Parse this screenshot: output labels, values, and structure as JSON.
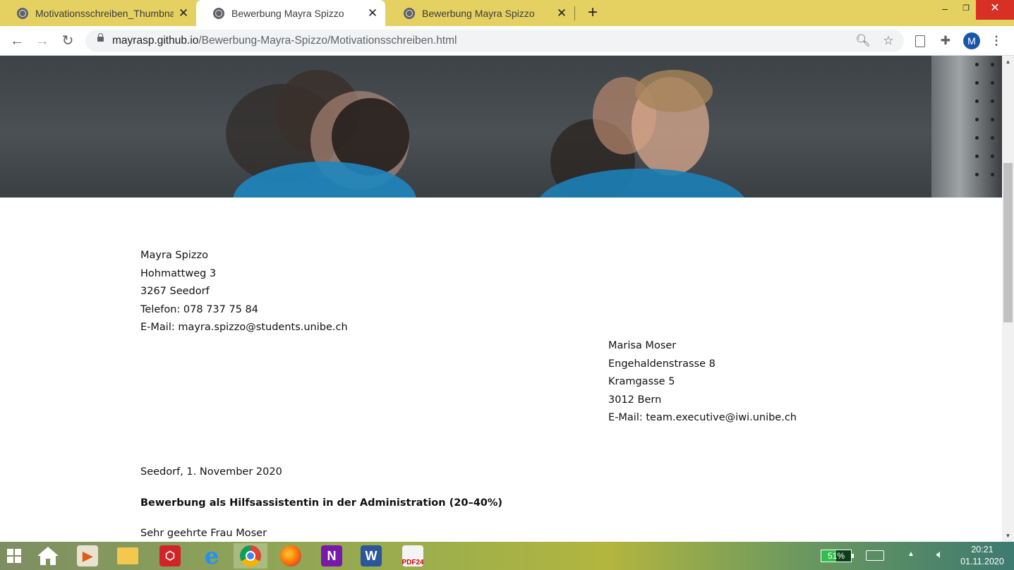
{
  "tabs": [
    {
      "title": "Motivationsschreiben_Thumbnail",
      "active": false,
      "icon": "globe-icon"
    },
    {
      "title": "Bewerbung Mayra Spizzo",
      "active": true,
      "icon": "globe-icon"
    },
    {
      "title": "Bewerbung Mayra Spizzo",
      "active": false,
      "icon": "globe-icon"
    }
  ],
  "address": {
    "host": "mayrasp.github.io",
    "path": "/Bewerbung-Mayra-Spizzo/Motivationsschreiben.html"
  },
  "profile": {
    "initial": "M"
  },
  "letter": {
    "sender": [
      "Mayra Spizzo",
      "Hohmattweg 3",
      "3267 Seedorf",
      "Telefon: 078 737 75 84",
      "E-Mail: mayra.spizzo@students.unibe.ch"
    ],
    "recipient": [
      "Marisa Moser",
      "Engehaldenstrasse 8",
      "Kramgasse 5",
      "3012 Bern",
      "E-Mail: team.executive@iwi.unibe.ch"
    ],
    "date": "Seedorf, 1. November 2020",
    "subject": "Bewerbung als Hilfsassistentin in der Administration (20–40%)",
    "salutation": "Sehr geehrte Frau Moser"
  },
  "taskbar": {
    "battery": "51%",
    "battery_level": 0.51,
    "time": "20:21",
    "date": "01.11.2020",
    "apps": [
      "start-button",
      "home-icon",
      "media-player-icon",
      "file-explorer-icon",
      "3d-app-icon",
      "internet-explorer-icon",
      "chrome-icon",
      "firefox-icon",
      "onenote-icon",
      "word-icon",
      "pdf24-icon"
    ]
  },
  "colors": {
    "tab_strip": "#e4d161",
    "avatar": "#1a56a8",
    "close_button": "#d93025"
  }
}
